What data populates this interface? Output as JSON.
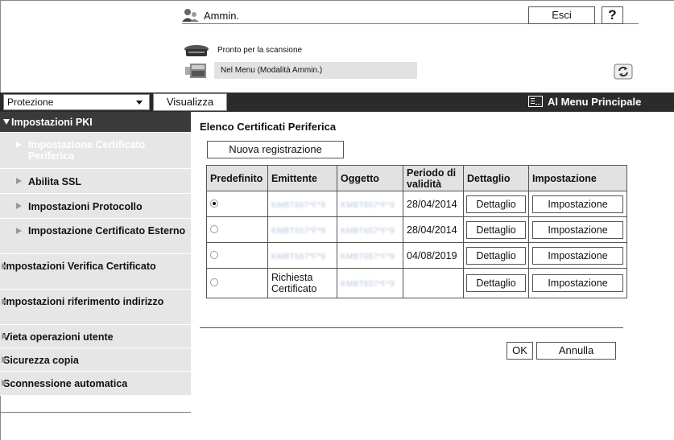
{
  "header": {
    "user_name": "Ammin.",
    "logout_label": "Esci",
    "help_label": "?",
    "status_scan": "Pronto per la scansione",
    "status_mode": "Nel Menu (Modalità Ammin.)"
  },
  "navbar": {
    "category_value": "Protezione",
    "show_label": "Visualizza",
    "main_menu_label": "Al Menu Principale"
  },
  "sidebar": {
    "top": "Impostazioni PKI",
    "sub": [
      "Impostazione Certificato Periferica",
      "Abilita SSL",
      "Impostazioni Protocollo",
      "Impostazione Certificato Esterno"
    ],
    "main": [
      "Impostazioni Verifica Certificato",
      "Impostazioni riferimento indirizzo",
      "Vieta operazioni utente",
      "Sicurezza copia",
      "Sconnessione automatica"
    ]
  },
  "content": {
    "title": "Elenco Certificati Periferica",
    "new_registration_label": "Nuova registrazione",
    "columns": [
      "Predefinito",
      "Emittente",
      "Oggetto",
      "Periodo di validità",
      "Dettaglio",
      "Impostazione"
    ],
    "rows": [
      {
        "selected": true,
        "issuer": "KMBT657*F*9",
        "subject": "KMBT657*F*9",
        "validity": "28/04/2014",
        "detail": "Dettaglio",
        "setting": "Impostazione"
      },
      {
        "selected": false,
        "issuer": "KMBT657*F*9",
        "subject": "KMBT657*F*9",
        "validity": "28/04/2014",
        "detail": "Dettaglio",
        "setting": "Impostazione"
      },
      {
        "selected": false,
        "issuer": "KMBT657*F*9",
        "subject": "KMBT657*F*9",
        "validity": "04/08/2019",
        "detail": "Dettaglio",
        "setting": "Impostazione"
      },
      {
        "selected": false,
        "issuer": "Richiesta Certificato",
        "subject": "KMBT657*F*9",
        "validity": "",
        "detail": "Dettaglio",
        "setting": "Impostazione"
      }
    ],
    "ok_label": "OK",
    "cancel_label": "Annulla"
  },
  "icons": {
    "user": "user-admin-icon",
    "scanner": "scanner-icon",
    "device": "device-icon",
    "refresh": "refresh-icon",
    "main_menu": "main-menu-icon"
  }
}
